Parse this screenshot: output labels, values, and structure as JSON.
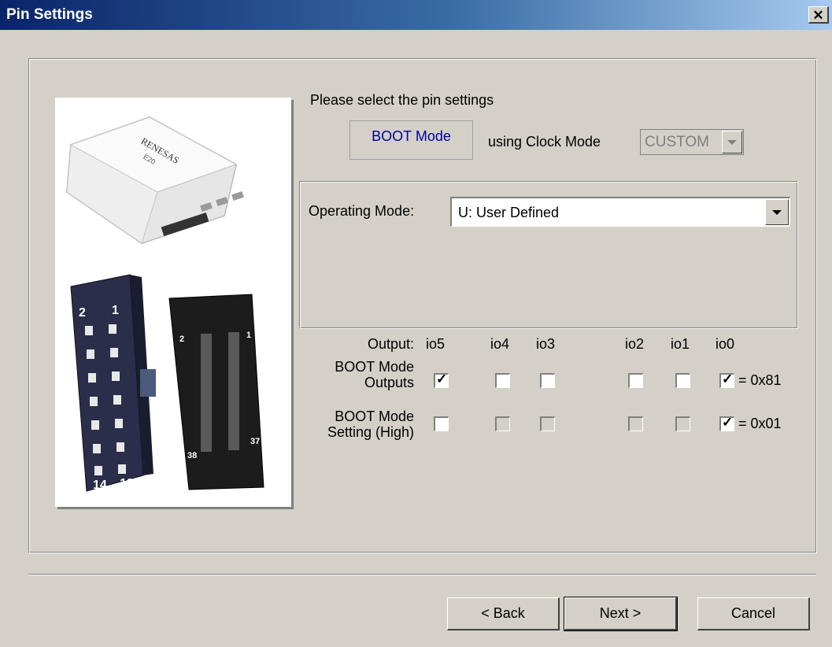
{
  "window": {
    "title": "Pin Settings",
    "close_glyph": "✕"
  },
  "intro": {
    "prompt": "Please select the pin settings",
    "boot_mode_label": "BOOT Mode",
    "using_clock_label": "using Clock Mode"
  },
  "clock_mode": {
    "value": "CUSTOM"
  },
  "operating_mode": {
    "label": "Operating Mode:",
    "value": "U: User Defined"
  },
  "image": {
    "brand": "RENESAS",
    "model": "E20",
    "left_header_pins": [
      "2",
      "1",
      "14",
      "13"
    ],
    "right_header_pins": [
      "2",
      "1",
      "38",
      "37"
    ]
  },
  "grid": {
    "output_label": "Output:",
    "columns": [
      "io5",
      "io4",
      "io3",
      "io2",
      "io1",
      "io0"
    ],
    "row1_label_a": "BOOT Mode",
    "row1_label_b": "Outputs",
    "row1_checked": [
      true,
      false,
      false,
      false,
      false,
      true
    ],
    "row1_value": "= 0x81",
    "row2_label_a": "BOOT Mode",
    "row2_label_b": "Setting (High)",
    "row2_checked": [
      false,
      false,
      false,
      false,
      false,
      true
    ],
    "row2_value": "= 0x01",
    "check_glyph": "✓"
  },
  "buttons": {
    "back": "< Back",
    "next": "Next >",
    "cancel": "Cancel"
  }
}
